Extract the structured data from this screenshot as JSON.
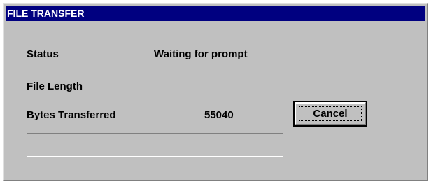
{
  "window": {
    "title": "FILE TRANSFER"
  },
  "status": {
    "label": "Status",
    "value": "Waiting for prompt"
  },
  "file_length": {
    "label": "File Length",
    "value": ""
  },
  "bytes_transferred": {
    "label": "Bytes Transferred",
    "value": "55040"
  },
  "buttons": {
    "cancel_label": "Cancel"
  },
  "progress": {
    "fraction": 0
  },
  "colors": {
    "titlebar": "#000080",
    "face": "#c0c0c0"
  }
}
